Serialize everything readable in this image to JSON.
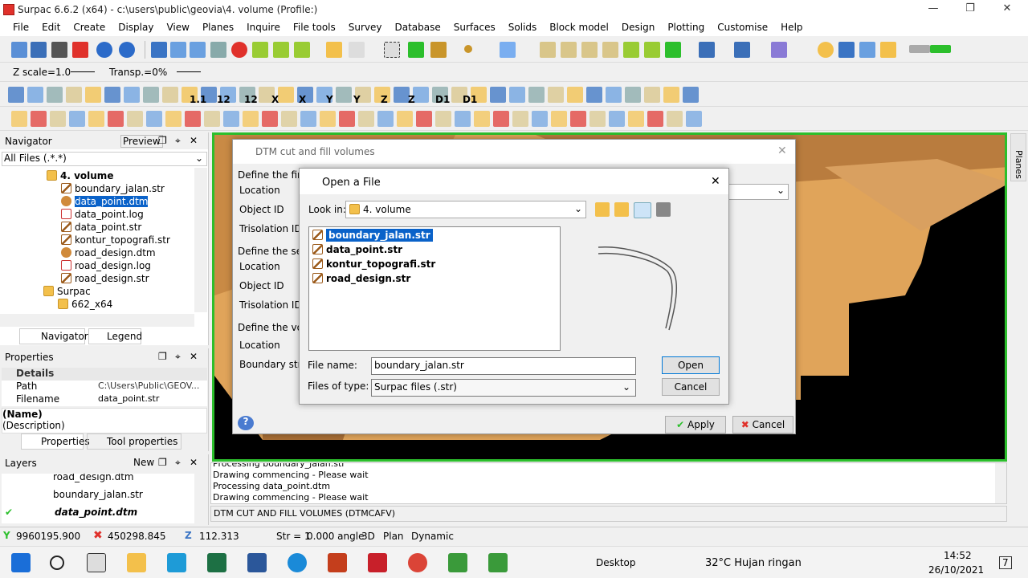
{
  "window": {
    "title": "Surpac 6.6.2 (x64) - c:\\users\\public\\geovia\\4. volume (Profile:)"
  },
  "menu": [
    "File",
    "Edit",
    "Create",
    "Display",
    "View",
    "Planes",
    "Inquire",
    "File tools",
    "Survey",
    "Database",
    "Surfaces",
    "Solids",
    "Block model",
    "Design",
    "Plotting",
    "Customise",
    "Help"
  ],
  "toolbar2": {
    "zscale": "Z scale=1.0",
    "transp": "Transp.=0%"
  },
  "toolbar3": {
    "labels": [
      "1.1",
      "12",
      "12",
      "X",
      "X",
      "Y",
      "Y",
      "Z",
      "Z",
      "D1",
      "D1"
    ]
  },
  "navigator": {
    "title": "Navigator",
    "preview": "Preview",
    "filter": "All Files (.*.*)",
    "items": [
      {
        "label": "4. volume",
        "type": "folder"
      },
      {
        "label": "boundary_jalan.str",
        "type": "str"
      },
      {
        "label": "data_point.dtm",
        "type": "dtm"
      },
      {
        "label": "data_point.log",
        "type": "log"
      },
      {
        "label": "data_point.str",
        "type": "str"
      },
      {
        "label": "kontur_topografi.str",
        "type": "str"
      },
      {
        "label": "road_design.dtm",
        "type": "dtm"
      },
      {
        "label": "road_design.log",
        "type": "log"
      },
      {
        "label": "road_design.str",
        "type": "str"
      },
      {
        "label": "Surpac",
        "type": "folder"
      },
      {
        "label": "662_x64",
        "type": "folder"
      }
    ],
    "tab_navigator": "Navigator",
    "tab_legend": "Legend"
  },
  "properties": {
    "title": "Properties",
    "section": "Details",
    "rows": [
      {
        "key": "Path",
        "value": "C:\\Users\\Public\\GEOV..."
      },
      {
        "key": "Filename",
        "value": "data_point.str"
      }
    ],
    "name": "(Name)",
    "description": "(Description)",
    "tab_properties": "Properties",
    "tab_tool": "Tool properties"
  },
  "layers": {
    "title": "Layers",
    "new": "New",
    "items": [
      "road_design.dtm",
      "boundary_jalan.str",
      "data_point.dtm"
    ]
  },
  "dtm_dialog": {
    "title": "DTM cut and fill volumes",
    "first": "Define the first D",
    "location": "Location",
    "object": "Object ID",
    "trisolation": "Trisolation ID",
    "second": "Define the secor",
    "volume": "Define the volum",
    "boundary": "Boundary string",
    "apply": "Apply",
    "cancel": "Cancel"
  },
  "open_dialog": {
    "title": "Open a File",
    "look_in_label": "Look in:",
    "look_in": "4. volume",
    "files": [
      "boundary_jalan.str",
      "data_point.str",
      "kontur_topografi.str",
      "road_design.str"
    ],
    "filename_label": "File name:",
    "filename": "boundary_jalan.str",
    "filetype_label": "Files of type:",
    "filetype": "Surpac files (.str)",
    "open": "Open",
    "cancel": "Cancel"
  },
  "messages": {
    "lines": [
      "Processing boundary_jalan.str",
      "Drawing commencing - Please wait",
      "Processing data_point.dtm",
      "Drawing commencing - Please wait"
    ],
    "command": "DTM CUT AND FILL VOLUMES (DTMCAFV)"
  },
  "status": {
    "y": "9960195.900",
    "x": "450298.845",
    "z": "112.313",
    "str": "Str = 1",
    "angle": "0.000 angle",
    "mode3d": "3D",
    "plan": "Plan",
    "dynamic": "Dynamic"
  },
  "side_tab": "Planes",
  "taskbar": {
    "desktop": "Desktop",
    "weather": "32°C  Hujan ringan",
    "time": "14:52",
    "date": "26/10/2021",
    "notif": "7"
  }
}
